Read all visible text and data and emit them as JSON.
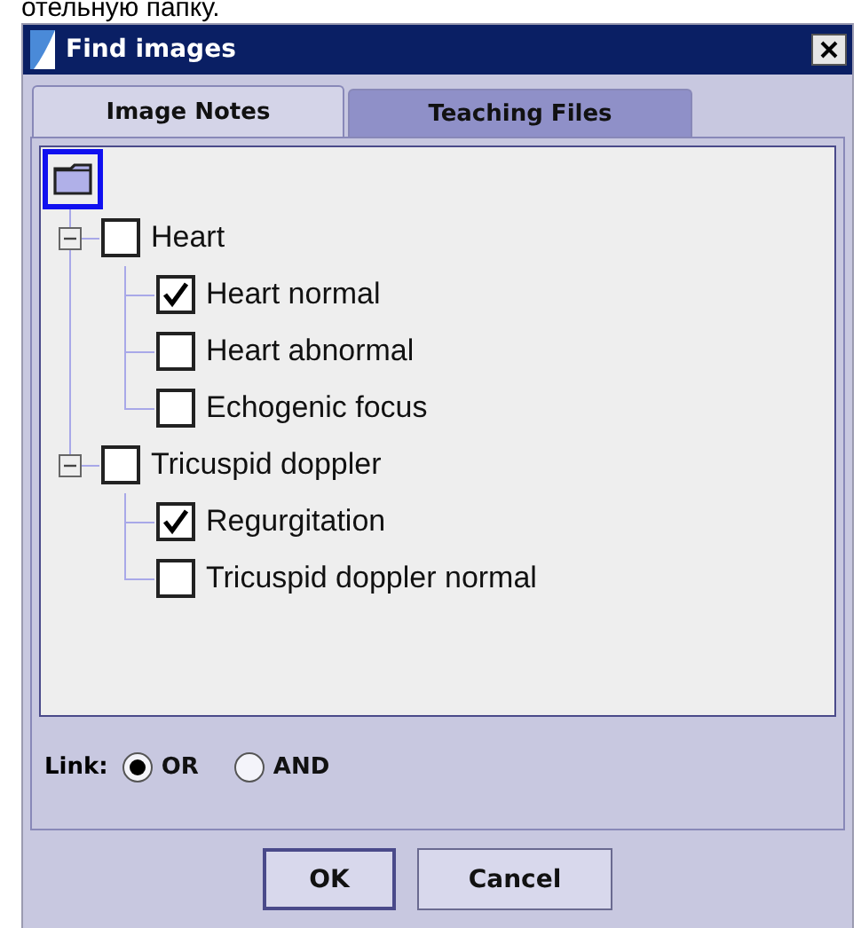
{
  "page_text": "отельную папку.",
  "window": {
    "title": "Find images"
  },
  "tabs": [
    {
      "label": "Image Notes",
      "selected": true
    },
    {
      "label": "Teaching Files",
      "selected": false
    }
  ],
  "tree": {
    "root_selected": true,
    "groups": [
      {
        "label": "Heart",
        "checked": false,
        "expanded": true,
        "children": [
          {
            "label": "Heart normal",
            "checked": true
          },
          {
            "label": "Heart abnormal",
            "checked": false
          },
          {
            "label": "Echogenic focus",
            "checked": false
          }
        ]
      },
      {
        "label": "Tricuspid doppler",
        "checked": false,
        "expanded": true,
        "children": [
          {
            "label": "Regurgitation",
            "checked": true
          },
          {
            "label": "Tricuspid doppler normal",
            "checked": false
          }
        ]
      }
    ]
  },
  "link": {
    "label": "Link:",
    "options": [
      {
        "label": "OR",
        "selected": true
      },
      {
        "label": "AND",
        "selected": false
      }
    ]
  },
  "buttons": [
    {
      "label": "OK",
      "kind": "default"
    },
    {
      "label": "Cancel",
      "kind": "normal"
    }
  ]
}
